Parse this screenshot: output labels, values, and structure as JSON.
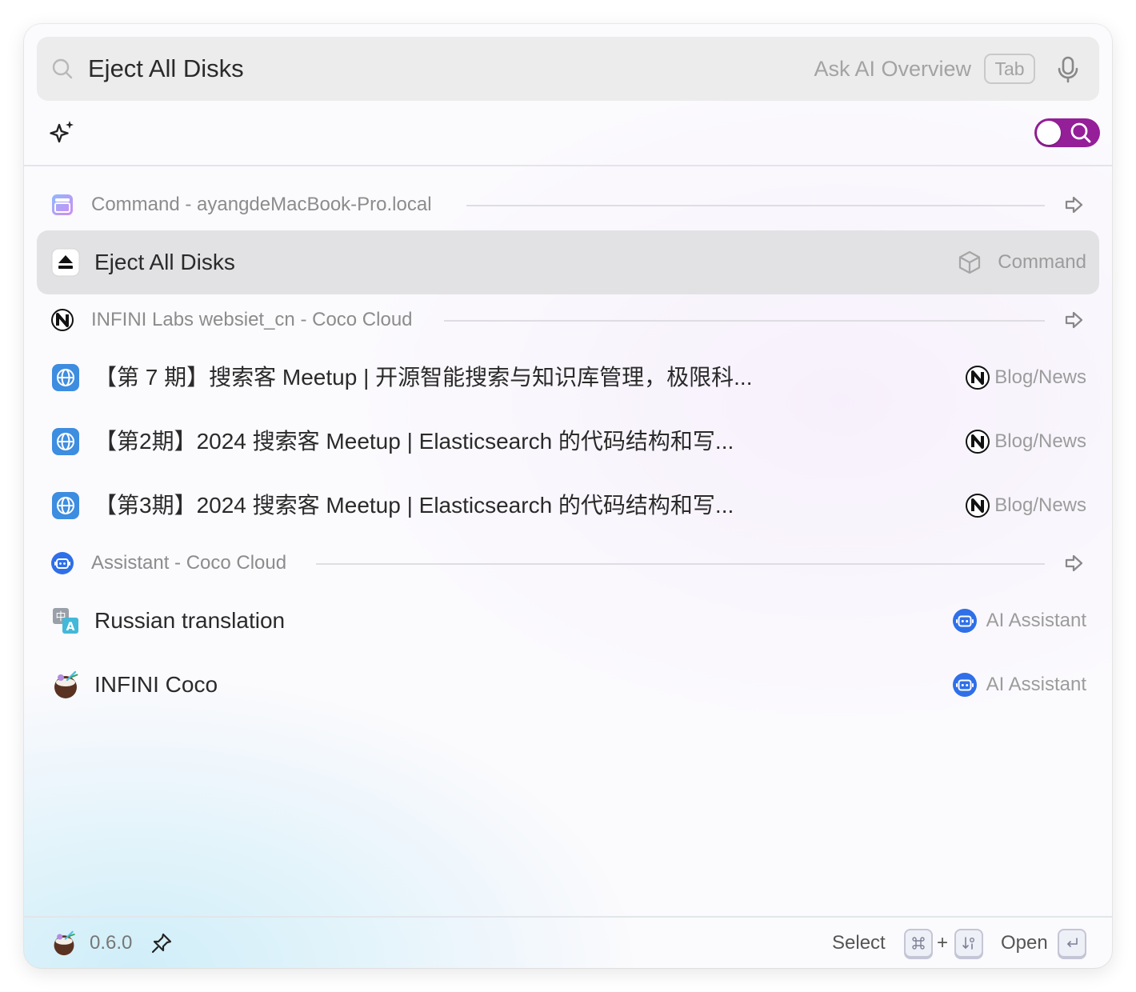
{
  "search": {
    "query": "Eject All Disks",
    "ask_ai_label": "Ask AI Overview",
    "tab_key_label": "Tab"
  },
  "toggle": {
    "mode": "search",
    "color": "#941f98"
  },
  "sections": [
    {
      "title": "Command - ayangdeMacBook-Pro.local",
      "icon": "app-window-icon",
      "items": [
        {
          "title": "Eject All Disks",
          "icon": "eject-icon",
          "type": "Command",
          "type_icon": "cube-icon",
          "selected": true
        }
      ]
    },
    {
      "title": "INFINI Labs websiet_cn - Coco Cloud",
      "icon": "infini-labs-icon",
      "items": [
        {
          "title": "【第 7 期】搜索客 Meetup | 开源智能搜索与知识库管理，极限科...",
          "icon": "globe-icon",
          "type": "Blog/News",
          "type_icon": "infini-labs-icon"
        },
        {
          "title": "【第2期】2024 搜索客 Meetup | Elasticsearch 的代码结构和写...",
          "icon": "globe-icon",
          "type": "Blog/News",
          "type_icon": "infini-labs-icon"
        },
        {
          "title": "【第3期】2024 搜索客 Meetup | Elasticsearch 的代码结构和写...",
          "icon": "globe-icon",
          "type": "Blog/News",
          "type_icon": "infini-labs-icon"
        }
      ]
    },
    {
      "title": "Assistant - Coco Cloud",
      "icon": "robot-icon",
      "items": [
        {
          "title": "Russian translation",
          "icon": "translate-icon",
          "type": "AI Assistant",
          "type_icon": "robot-icon"
        },
        {
          "title": "INFINI Coco",
          "icon": "coconut-icon",
          "type": "AI Assistant",
          "type_icon": "robot-icon"
        }
      ]
    }
  ],
  "footer": {
    "version": "0.6.0",
    "select_label": "Select",
    "plus": "+",
    "open_label": "Open"
  }
}
